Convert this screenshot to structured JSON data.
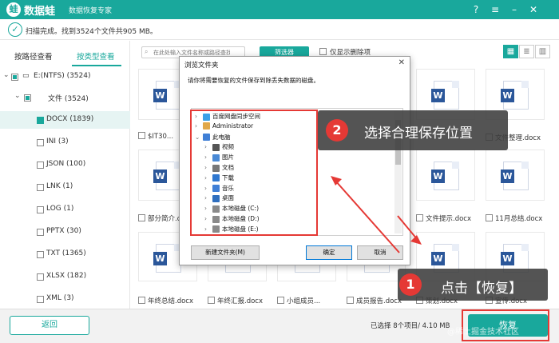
{
  "titlebar": {
    "app_name": "数据蛙",
    "subtitle": "数据恢复专家",
    "logo_glyph": "蛙",
    "icons": [
      "help-icon",
      "menu-icon",
      "minimize-icon",
      "close-icon"
    ]
  },
  "status": {
    "text": "扫描完成。找到3524个文件共905 MB。"
  },
  "left_panel": {
    "tabs": [
      "按路径查看",
      "按类型查看"
    ],
    "active_tab": "按类型查看",
    "tree": [
      {
        "label": "E:(NTFS) (3524)"
      },
      {
        "label": "文件 (3524)"
      },
      {
        "label": "DOCX (1839)",
        "selected": true
      },
      {
        "label": "INI (3)"
      },
      {
        "label": "JSON (100)"
      },
      {
        "label": "LNK (1)"
      },
      {
        "label": "LOG (1)"
      },
      {
        "label": "PPTX (30)"
      },
      {
        "label": "TXT (1365)"
      },
      {
        "label": "XLSX (182)"
      },
      {
        "label": "XML (3)"
      }
    ]
  },
  "toolbar": {
    "search_placeholder": "在此处输入文件名称或路径查找",
    "filter_label": "筛选器",
    "only_deleted_label": "仅显示删除项"
  },
  "files": [
    {
      "name": "$IT30...",
      "row": 0,
      "col": 0
    },
    {
      "name": "文件整理.docx",
      "row": 0,
      "col": 5
    },
    {
      "name": "部分简介.d...",
      "row": 1,
      "col": 0
    },
    {
      "name": "文件提示.docx",
      "row": 1,
      "col": 4
    },
    {
      "name": "11月总结.docx",
      "row": 1,
      "col": 5
    },
    {
      "name": "年终总结.docx",
      "row": 2,
      "col": 0
    },
    {
      "name": "年终汇报.docx",
      "row": 2,
      "col": 1
    },
    {
      "name": "小组成员...",
      "row": 2,
      "col": 2
    },
    {
      "name": "成员报告.docx",
      "row": 2,
      "col": 3
    },
    {
      "name": "策划.docx",
      "row": 2,
      "col": 4
    },
    {
      "name": "宣传.docx",
      "row": 2,
      "col": 5
    }
  ],
  "dialog": {
    "title": "浏览文件夹",
    "prompt": "请你将需要恢复的文件保存到除丢失数据的磁盘。",
    "nodes": [
      {
        "label": "百度网盘同步空间",
        "icon": "cloud-folder-icon",
        "level": 0,
        "expander": "›"
      },
      {
        "label": "Administrator",
        "icon": "user-folder-icon",
        "level": 0,
        "expander": "›"
      },
      {
        "label": "此电脑",
        "icon": "computer-icon",
        "level": 0,
        "expander": "⌄"
      },
      {
        "label": "视频",
        "icon": "video-folder-icon",
        "level": 1,
        "expander": "›"
      },
      {
        "label": "图片",
        "icon": "pictures-folder-icon",
        "level": 1,
        "expander": "›"
      },
      {
        "label": "文档",
        "icon": "documents-folder-icon",
        "level": 1,
        "expander": "›"
      },
      {
        "label": "下载",
        "icon": "downloads-folder-icon",
        "level": 1,
        "expander": "›"
      },
      {
        "label": "音乐",
        "icon": "music-folder-icon",
        "level": 1,
        "expander": "›"
      },
      {
        "label": "桌面",
        "icon": "desktop-folder-icon",
        "level": 1,
        "expander": "›"
      },
      {
        "label": "本地磁盘 (C:)",
        "icon": "drive-icon",
        "level": 1,
        "expander": "›"
      },
      {
        "label": "本地磁盘 (D:)",
        "icon": "drive-icon",
        "level": 1,
        "expander": "›"
      },
      {
        "label": "本地磁盘 (E:)",
        "icon": "drive-icon",
        "level": 1,
        "expander": "›"
      }
    ],
    "new_folder_label": "新建文件夹(M)",
    "ok_label": "确定",
    "cancel_label": "取消"
  },
  "annotations": {
    "step2_number": "2",
    "step2_text": "选择合理保存位置",
    "step1_number": "1",
    "step1_text": "点击【恢复】"
  },
  "bottom": {
    "back_label": "返回",
    "selected_info": "已选择 8个项目/ 4.10 MB",
    "recover_label": "恢复"
  },
  "watermark": "@稀土掘金技术社区",
  "colors": {
    "brand": "#19a89c",
    "highlight": "#e53935",
    "word_blue": "#2b579a"
  }
}
